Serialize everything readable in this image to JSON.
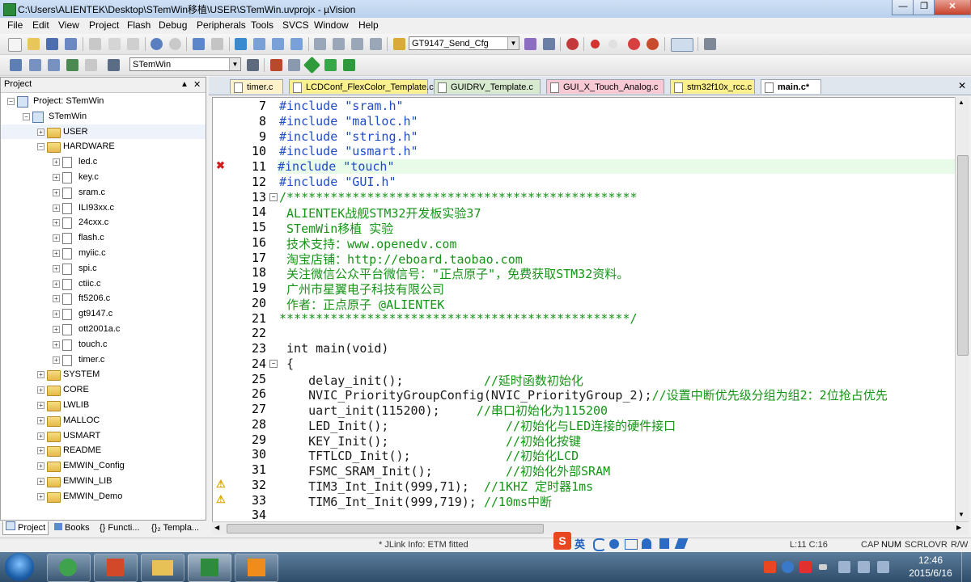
{
  "window": {
    "title": "C:\\Users\\ALIENTEK\\Desktop\\STemWin移植\\USER\\STemWin.uvprojx - µVision"
  },
  "menu": [
    "File",
    "Edit",
    "View",
    "Project",
    "Flash",
    "Debug",
    "Peripherals",
    "Tools",
    "SVCS",
    "Window",
    "Help"
  ],
  "toolbar": {
    "find_combo": "GT9147_Send_Cfg",
    "target_combo": "STemWin"
  },
  "project_panel": {
    "title": "Project",
    "root": "Project: STemWin",
    "target": "STemWin",
    "groups_top": [
      "USER",
      "HARDWARE"
    ],
    "hardware_files": [
      "led.c",
      "key.c",
      "sram.c",
      "ILI93xx.c",
      "24cxx.c",
      "flash.c",
      "myiic.c",
      "spi.c",
      "ctiic.c",
      "ft5206.c",
      "gt9147.c",
      "ott2001a.c",
      "touch.c",
      "timer.c"
    ],
    "groups_bottom": [
      "SYSTEM",
      "CORE",
      "LWLIB",
      "MALLOC",
      "USMART",
      "README",
      "EMWIN_Config",
      "EMWIN_LIB",
      "EMWIN_Demo"
    ],
    "tabs": [
      "Project",
      "Books",
      "{} Functi...",
      "{}₂ Templa..."
    ]
  },
  "editor_tabs": [
    "timer.c",
    "LCDConf_FlexColor_Template.c",
    "GUIDRV_Template.c",
    "GUI_X_Touch_Analog.c",
    "stm32f10x_rcc.c",
    "main.c*"
  ],
  "code_lines": [
    {
      "n": "7",
      "t": "#include \"sram.h\""
    },
    {
      "n": "8",
      "t": "#include \"malloc.h\""
    },
    {
      "n": "9",
      "t": "#include \"string.h\""
    },
    {
      "n": "10",
      "t": "#include \"usmart.h\""
    },
    {
      "n": "11",
      "t": "#include \"touch\""
    },
    {
      "n": "12",
      "t": "#include \"GUI.h\""
    },
    {
      "n": "13",
      "t": "/************************************************"
    },
    {
      "n": "14",
      "t": " ALIENTEK战舰STM32开发板实验37"
    },
    {
      "n": "15",
      "t": " STemWin移植 实验"
    },
    {
      "n": "16",
      "t": " 技术支持：www.openedv.com"
    },
    {
      "n": "17",
      "t": " 淘宝店铺：http://eboard.taobao.com"
    },
    {
      "n": "18",
      "t": " 关注微信公众平台微信号：\"正点原子\"，免费获取STM32资料。"
    },
    {
      "n": "19",
      "t": " 广州市星翼电子科技有限公司"
    },
    {
      "n": "20",
      "t": " 作者：正点原子 @ALIENTEK"
    },
    {
      "n": "21",
      "t": "************************************************/"
    },
    {
      "n": "22",
      "t": ""
    },
    {
      "n": "23",
      "t": " int main(void)"
    },
    {
      "n": "24",
      "t": " {"
    },
    {
      "n": "25",
      "t": "    delay_init();           //延时函数初始化"
    },
    {
      "n": "26",
      "t": "    NVIC_PriorityGroupConfig(NVIC_PriorityGroup_2);//设置中断优先级分组为组2：2位抢占优先"
    },
    {
      "n": "27",
      "t": "    uart_init(115200);     //串口初始化为115200"
    },
    {
      "n": "28",
      "t": "    LED_Init();                //初始化与LED连接的硬件接口"
    },
    {
      "n": "29",
      "t": "    KEY_Init();                //初始化按键"
    },
    {
      "n": "30",
      "t": "    TFTLCD_Init();             //初始化LCD"
    },
    {
      "n": "31",
      "t": "    FSMC_SRAM_Init();          //初始化外部SRAM"
    },
    {
      "n": "32",
      "t": "    TIM3_Int_Init(999,71);  //1KHZ 定时器1ms"
    },
    {
      "n": "33",
      "t": "    TIM6_Int_Init(999,719); //10ms中断"
    },
    {
      "n": "34",
      "t": ""
    }
  ],
  "status": {
    "jlink": "* JLink Info: ETM fitted",
    "cursor": "L:11 C:16",
    "caps": "CAP",
    "num": "NUM",
    "scrl": "SCRL",
    "ovr": "OVR",
    "rw": "R/W",
    "ime": "英"
  },
  "clock": {
    "time": "12:46",
    "date": "2015/6/16"
  }
}
